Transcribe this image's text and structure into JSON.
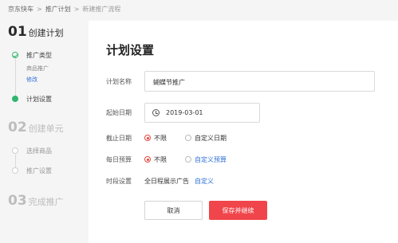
{
  "breadcrumb": {
    "items": [
      "京东快车",
      "推广计划"
    ],
    "current": "新建推广流程"
  },
  "sidebar": {
    "step1": {
      "num": "01",
      "title": "创建计划"
    },
    "step1_items": {
      "type_label": "推广类型",
      "type_value": "商品推广",
      "edit_link": "修改",
      "settings_label": "计划设置"
    },
    "step2": {
      "num": "02",
      "title": "创建单元"
    },
    "step2_items": {
      "select_products": "选择商品",
      "promo_settings": "推广设置"
    },
    "step3": {
      "num": "03",
      "title": "完成推广"
    }
  },
  "form": {
    "heading": "计划设置",
    "plan_name_label": "计划名称",
    "plan_name_value": "蝴蝶节推广",
    "start_date_label": "起始日期",
    "start_date_value": "2019-03-01",
    "end_date_label": "截止日期",
    "end_option_unlimited": "不限",
    "end_option_custom": "自定义日期",
    "budget_label": "每日预算",
    "budget_option_unlimited": "不限",
    "budget_option_custom": "自定义预算",
    "schedule_label": "时段设置",
    "schedule_value": "全日程展示广告",
    "schedule_custom": "自定义"
  },
  "buttons": {
    "cancel": "取消",
    "save": "保存并继续"
  },
  "colors": {
    "primary": "#f0454a",
    "success": "#31b46e",
    "link": "#2f6fd6"
  }
}
